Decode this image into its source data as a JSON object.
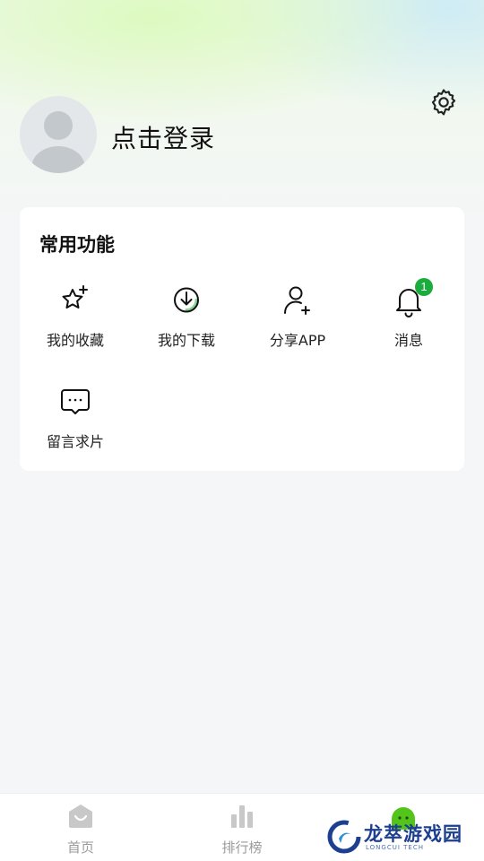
{
  "profile": {
    "login_label": "点击登录"
  },
  "functions": {
    "title": "常用功能",
    "items": [
      {
        "icon": "star-sparkle-icon",
        "label": "我的收藏"
      },
      {
        "icon": "download-icon",
        "label": "我的下载"
      },
      {
        "icon": "add-user-icon",
        "label": "分享APP"
      },
      {
        "icon": "bell-icon",
        "label": "消息",
        "badge": "1"
      },
      {
        "icon": "chat-bubble-icon",
        "label": "留言求片"
      }
    ]
  },
  "tabbar": {
    "items": [
      {
        "icon": "home-icon",
        "label": "首页"
      },
      {
        "icon": "bar-chart-icon",
        "label": "排行榜"
      },
      {
        "icon": "profile-mascot-icon",
        "label": ""
      }
    ]
  },
  "watermark": {
    "name": "龙萃游戏园",
    "sub": "LONGCUI TECH"
  },
  "colors": {
    "accent": "#1aad3d",
    "text": "#111111",
    "tab_inactive": "#9a9a9a"
  }
}
